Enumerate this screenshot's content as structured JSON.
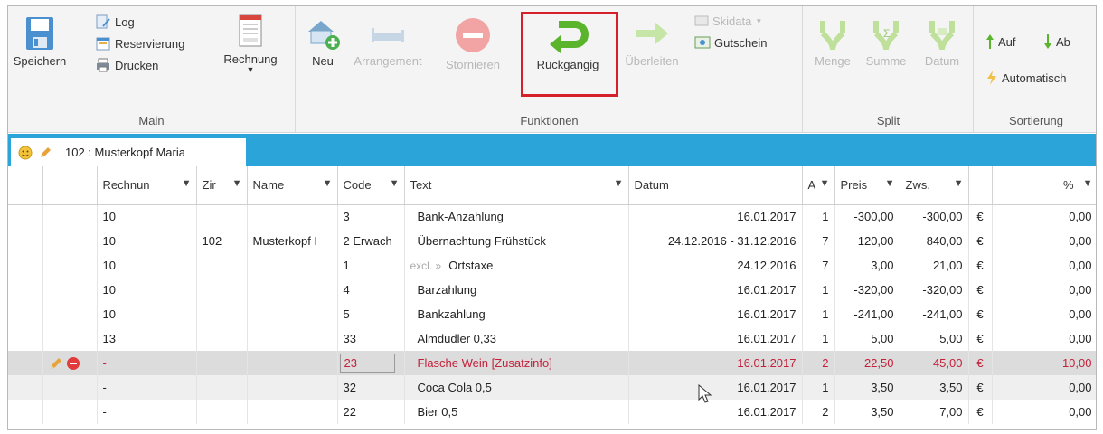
{
  "ribbon": {
    "main": {
      "group_label": "Main",
      "save_label": "Speichern",
      "log_label": "Log",
      "reservation_label": "Reservierung",
      "print_label": "Drucken",
      "invoice_label": "Rechnung"
    },
    "functions": {
      "group_label": "Funktionen",
      "new_label": "Neu",
      "arrangement_label": "Arrangement",
      "cancel_label": "Stornieren",
      "undo_label": "Rückgängig",
      "transfer_label": "Überleiten",
      "skidata_label": "Skidata",
      "voucher_label": "Gutschein"
    },
    "split": {
      "group_label": "Split",
      "amount_label": "Menge",
      "sum_label": "Summe",
      "date_label": "Datum"
    },
    "sort": {
      "group_label": "Sortierung",
      "up_label": "Auf",
      "down_label": "Ab",
      "auto_label": "Automatisch"
    }
  },
  "tab": {
    "label": "102 : Musterkopf Maria"
  },
  "grid": {
    "headers": {
      "invoice": "Rechnun",
      "room": "Zir",
      "name": "Name",
      "code": "Code",
      "text": "Text",
      "date": "Datum",
      "qty": "A",
      "price": "Preis",
      "subtotal": "Zws.",
      "percent": "%"
    },
    "rows": [
      {
        "invoice": "10",
        "room": "",
        "name": "",
        "code": "3",
        "excl": "",
        "text": "Bank-Anzahlung",
        "date": "16.01.2017",
        "qty": "1",
        "price": "-300,00",
        "subtotal": "-300,00",
        "cur": "€",
        "pct": "0,00"
      },
      {
        "invoice": "10",
        "room": "102",
        "name": "Musterkopf I",
        "code": "2 Erwach",
        "excl": "",
        "text": "Übernachtung Frühstück",
        "date": "24.12.2016 - 31.12.2016",
        "qty": "7",
        "price": "120,00",
        "subtotal": "840,00",
        "cur": "€",
        "pct": "0,00"
      },
      {
        "invoice": "10",
        "room": "",
        "name": "",
        "code": "1",
        "excl": "excl.  »",
        "text": "Ortstaxe",
        "date": "24.12.2016",
        "qty": "7",
        "price": "3,00",
        "subtotal": "21,00",
        "cur": "€",
        "pct": "0,00"
      },
      {
        "invoice": "10",
        "room": "",
        "name": "",
        "code": "4",
        "excl": "",
        "text": "Barzahlung",
        "date": "16.01.2017",
        "qty": "1",
        "price": "-320,00",
        "subtotal": "-320,00",
        "cur": "€",
        "pct": "0,00"
      },
      {
        "invoice": "10",
        "room": "",
        "name": "",
        "code": "5",
        "excl": "",
        "text": "Bankzahlung",
        "date": "16.01.2017",
        "qty": "1",
        "price": "-241,00",
        "subtotal": "-241,00",
        "cur": "€",
        "pct": "0,00"
      },
      {
        "invoice": "13",
        "room": "",
        "name": "",
        "code": "33",
        "excl": "",
        "text": "Almdudler 0,33",
        "date": "16.01.2017",
        "qty": "1",
        "price": "5,00",
        "subtotal": "5,00",
        "cur": "€",
        "pct": "0,00"
      },
      {
        "invoice": "-",
        "room": "",
        "name": "",
        "code": "23",
        "excl": "",
        "text": "Flasche Wein [Zusatzinfo]",
        "date": "16.01.2017",
        "qty": "2",
        "price": "22,50",
        "subtotal": "45,00",
        "cur": "€",
        "pct": "10,00"
      },
      {
        "invoice": "-",
        "room": "",
        "name": "",
        "code": "32",
        "excl": "",
        "text": "Coca Cola 0,5",
        "date": "16.01.2017",
        "qty": "1",
        "price": "3,50",
        "subtotal": "3,50",
        "cur": "€",
        "pct": "0,00"
      },
      {
        "invoice": "-",
        "room": "",
        "name": "",
        "code": "22",
        "excl": "",
        "text": "Bier 0,5",
        "date": "16.01.2017",
        "qty": "2",
        "price": "3,50",
        "subtotal": "7,00",
        "cur": "€",
        "pct": "0,00"
      }
    ]
  },
  "colors": {
    "accent": "#2ba5d9",
    "highlight": "#d4202a",
    "undo_green": "#5bb52c",
    "cancel_red": "#e85b5b",
    "selected_text": "#c4203a"
  }
}
